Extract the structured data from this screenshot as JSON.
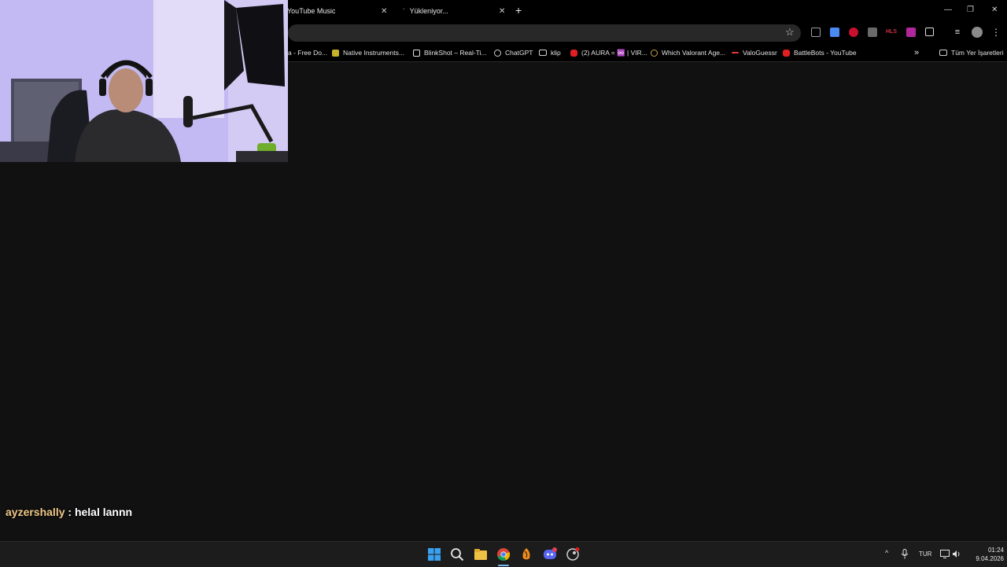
{
  "tabs": [
    {
      "label": "YouTube Music",
      "close": "✕"
    },
    {
      "label": "Yükleniyor...",
      "close": "✕"
    }
  ],
  "new_tab": "+",
  "window_controls": {
    "minimize": "—",
    "restore": "❐",
    "close": "✕"
  },
  "toolbar": {
    "star": "☆",
    "extensions": [
      {
        "icon": "screen-icon",
        "color": "#9aa0a6"
      },
      {
        "icon": "translate-icon",
        "color": "#4a8af4"
      },
      {
        "icon": "block-icon",
        "color": "#c8102e"
      },
      {
        "icon": "download-icon",
        "color": "#7a7a7a"
      },
      {
        "icon": "hls-icon",
        "label": "HLS",
        "color": "#d6304a"
      },
      {
        "icon": "ext-purple-icon",
        "color": "#b0279b"
      },
      {
        "icon": "puzzle-icon",
        "color": "#e0e0e0"
      },
      {
        "icon": "media-icon",
        "color": "#e0e0e0"
      },
      {
        "icon": "profile-avatar-icon",
        "color": "#8a8a8a"
      },
      {
        "icon": "menu-icon",
        "color": "#e0e0e0"
      }
    ]
  },
  "bookmarks": [
    {
      "label": "a - Free Do...",
      "icon": "page-icon",
      "color": "#6a6a6a"
    },
    {
      "label": "Native Instruments...",
      "icon": "ni-icon",
      "color": "#c5b12a"
    },
    {
      "label": "BlinkShot – Real-Ti...",
      "icon": "blinkshot-icon",
      "color": "#e0e0e0"
    },
    {
      "label": "ChatGPT",
      "icon": "chatgpt-icon",
      "color": "#d0d0d0"
    },
    {
      "label": "klip",
      "icon": "folder-icon",
      "color": "#d0d0d0"
    },
    {
      "label": "(2) AURA = ♾️ | VIR...",
      "icon": "youtube-icon",
      "color": "#e02020"
    },
    {
      "label": "Which Valorant Age...",
      "icon": "valorant-icon",
      "color": "#c9a14a"
    },
    {
      "label": "ValoGuessr",
      "icon": "valoguessr-icon",
      "color": "#e23a3a"
    },
    {
      "label": "BattleBots - YouTube",
      "icon": "youtube-icon",
      "color": "#e02020"
    }
  ],
  "bookmarks_more": "»",
  "all_bookmarks": "Tüm Yer İşaretleri",
  "chat": {
    "user": "ayzershally",
    "separator": " : ",
    "message": "helal lannn"
  },
  "taskbar": {
    "apps": [
      {
        "icon": "windows-start-icon"
      },
      {
        "icon": "search-icon"
      },
      {
        "icon": "file-explorer-icon"
      },
      {
        "icon": "chrome-icon"
      },
      {
        "icon": "fl-studio-icon"
      },
      {
        "icon": "discord-icon"
      },
      {
        "icon": "steam-icon"
      }
    ],
    "tray": {
      "chevron": "^",
      "language": "TUR"
    },
    "time": "01:24",
    "date": "9.04.2026"
  }
}
